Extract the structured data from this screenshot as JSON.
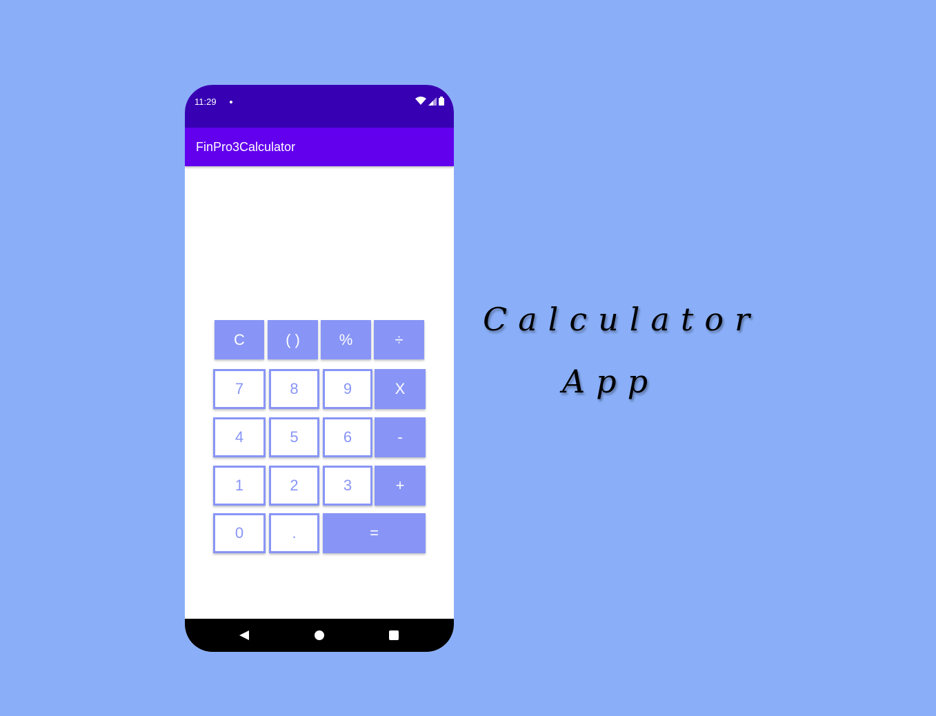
{
  "status_bar": {
    "time": "11:29"
  },
  "app_bar": {
    "title": "FinPro3Calculator"
  },
  "keypad": {
    "row1": [
      "C",
      "( )",
      "%",
      "÷"
    ],
    "row2": [
      "7",
      "8",
      "9",
      "X"
    ],
    "row3": [
      "4",
      "5",
      "6",
      "-"
    ],
    "row4": [
      "1",
      "2",
      "3",
      "+"
    ],
    "row5": [
      "0",
      ".",
      "="
    ]
  },
  "headline": {
    "line1": "Calculator",
    "line2": "App"
  },
  "colors": {
    "background": "#8aaff8",
    "status_bar": "#3700b3",
    "app_bar": "#6200ee",
    "key_accent": "#8895f6"
  }
}
